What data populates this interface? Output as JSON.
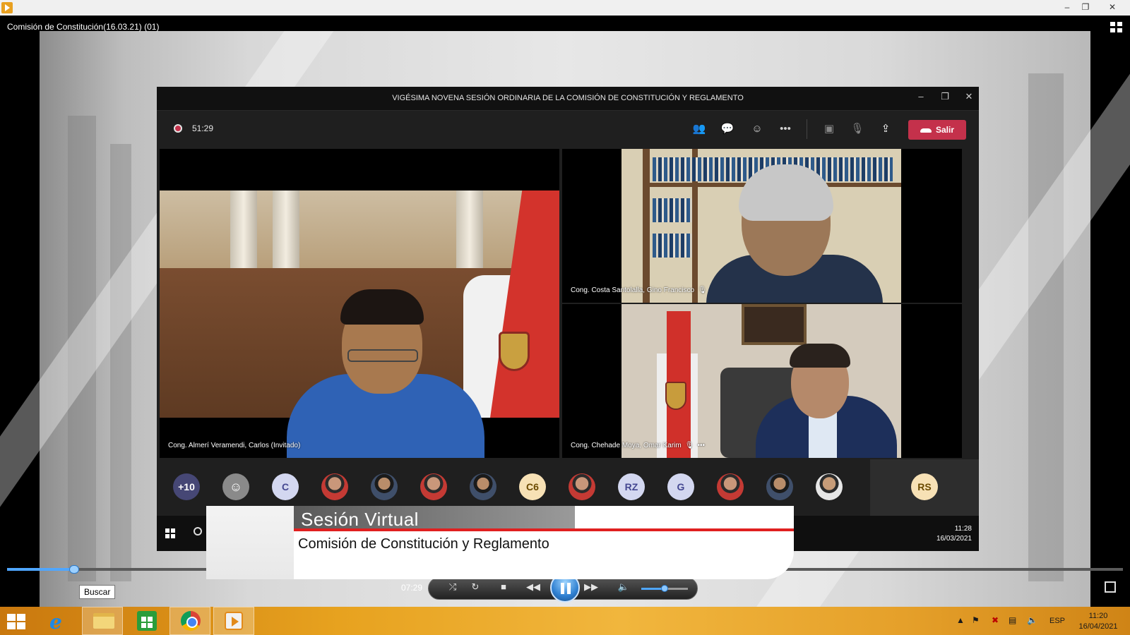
{
  "player": {
    "media_title": "Comisión de Constitución(16.03.21) (01)",
    "time_elapsed": "07:29",
    "seek_progress": 0.06,
    "volume_level": 0.5,
    "tooltip": "Buscar",
    "controls": [
      "shuffle-icon",
      "repeat-icon",
      "stop-icon",
      "previous-icon",
      "pause-icon",
      "next-icon",
      "volume-icon"
    ]
  },
  "teams": {
    "title": "VIGÉSIMA NOVENA SESIÓN ORDINARIA DE LA COMISIÓN DE CONSTITUCIÓN Y REGLAMENTO",
    "recording_time": "51:29",
    "leave_label": "Salir",
    "toolbar_icons": [
      "participants-icon",
      "chat-icon",
      "reactions-icon",
      "more-icon",
      "camera-off-icon",
      "mic-off-icon",
      "share-icon"
    ],
    "tiles": [
      {
        "label": "Cong. Almerí Veramendi, Carlos (Invitado)"
      },
      {
        "label": "Cong. Costa Santolalla, Gino Francisco"
      },
      {
        "label": "Cong. Chehade Moya, Omar Karim"
      }
    ],
    "participants": [
      {
        "kind": "count",
        "text": "+10",
        "bg": "#464775",
        "fg": "#ffffff"
      },
      {
        "kind": "generic",
        "text": "",
        "bg": "#8a8a8a",
        "fg": "#ffffff"
      },
      {
        "kind": "initials",
        "text": "C",
        "bg": "#d3d7f0",
        "fg": "#444791"
      },
      {
        "kind": "photo",
        "text": "",
        "variant": "red"
      },
      {
        "kind": "photo",
        "text": "",
        "variant": "dark"
      },
      {
        "kind": "photo",
        "text": "",
        "variant": "red"
      },
      {
        "kind": "photo",
        "text": "",
        "variant": "dark"
      },
      {
        "kind": "initials",
        "text": "C6",
        "bg": "#f7e1b5",
        "fg": "#6b4a00"
      },
      {
        "kind": "photo",
        "text": "",
        "variant": "red"
      },
      {
        "kind": "initials",
        "text": "RZ",
        "bg": "#d3d7f0",
        "fg": "#444791"
      },
      {
        "kind": "initials",
        "text": "G",
        "bg": "#d3d7f0",
        "fg": "#444791"
      },
      {
        "kind": "photo",
        "text": "",
        "variant": "red"
      },
      {
        "kind": "photo",
        "text": "",
        "variant": "dark"
      },
      {
        "kind": "photo",
        "text": "",
        "variant": "light"
      }
    ],
    "self_avatar": {
      "text": "RS",
      "bg": "#f7e1b5",
      "fg": "#6b4a00"
    },
    "inner_clock_time": "11:28",
    "inner_clock_date": "16/03/2021"
  },
  "overlay": {
    "title": "Sesión Virtual",
    "subtitle": "Comisión de Constitución y Reglamento"
  },
  "taskbar": {
    "apps": [
      "internet-explorer-icon",
      "file-explorer-icon",
      "store-icon",
      "chrome-icon",
      "media-player-icon"
    ],
    "language": "ESP",
    "clock_time": "11:20",
    "clock_date": "16/04/2021"
  }
}
